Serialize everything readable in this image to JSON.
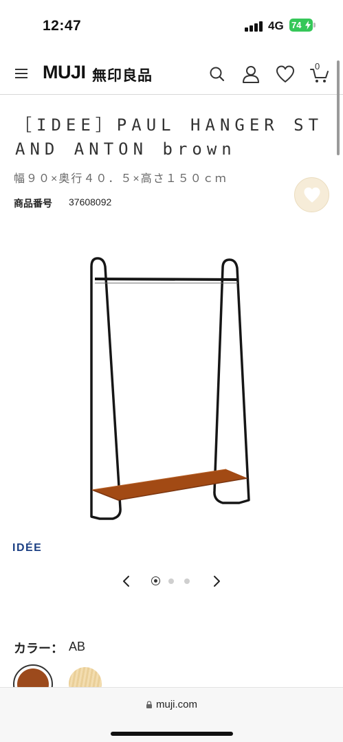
{
  "status_bar": {
    "time": "12:47",
    "network": "4G",
    "battery": "74"
  },
  "header": {
    "logo": "MUJI",
    "logo_jp": "無印良品",
    "cart_count": "0",
    "icons": [
      "menu-icon",
      "search-icon",
      "account-icon",
      "heart-icon",
      "cart-icon"
    ]
  },
  "product": {
    "title": "［IDEE］PAUL HANGER STAND ANTON brown",
    "dimensions": "幅９０×奥行４０．５×高さ１５０ｃｍ",
    "code_label": "商品番号",
    "code_value": "37608092",
    "brand_logo": "IDÉE"
  },
  "carousel": {
    "total": 3,
    "active": 1
  },
  "color": {
    "label": "カラー：",
    "value": "AB",
    "swatches": [
      {
        "color": "#9c4a1c",
        "selected": true
      },
      {
        "color": "#f0d8a6",
        "selected": false
      }
    ]
  },
  "browser": {
    "url": "muji.com"
  }
}
